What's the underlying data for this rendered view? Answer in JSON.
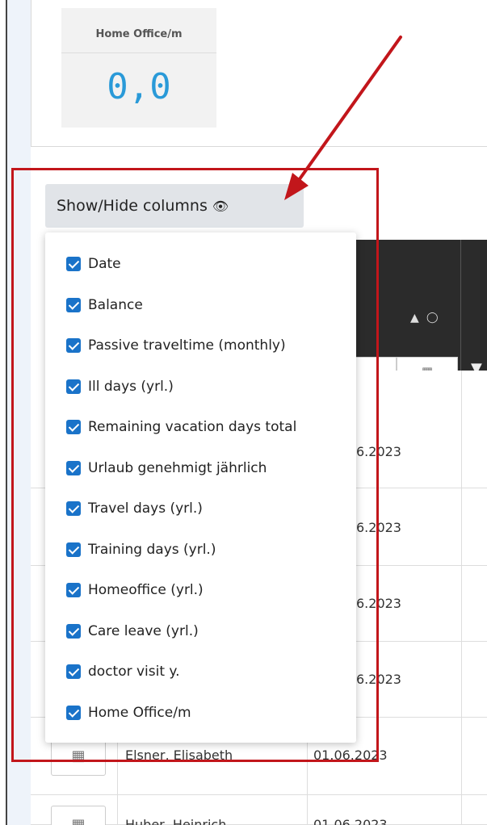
{
  "kpi": {
    "title": "Home Office/m",
    "value": "0,0"
  },
  "show_hide": {
    "label": "Show/Hide columns",
    "eye_icon": "eye-icon"
  },
  "columns": [
    {
      "label": "Date",
      "checked": true
    },
    {
      "label": "Balance",
      "checked": true
    },
    {
      "label": "Passive traveltime (monthly)",
      "checked": true
    },
    {
      "label": "Ill days (yrl.)",
      "checked": true
    },
    {
      "label": "Remaining vacation days total",
      "checked": true
    },
    {
      "label": "Urlaub genehmigt jährlich",
      "checked": true
    },
    {
      "label": "Travel days (yrl.)",
      "checked": true
    },
    {
      "label": "Training days (yrl.)",
      "checked": true
    },
    {
      "label": "Homeoffice (yrl.)",
      "checked": true
    },
    {
      "label": "Care leave (yrl.)",
      "checked": true
    },
    {
      "label": "doctor visit y.",
      "checked": true
    },
    {
      "label": "Home Office/m",
      "checked": true
    }
  ],
  "table": {
    "filter_placeholder": "-----",
    "rows": [
      {
        "date": "6.2023"
      },
      {
        "date": "6.2023"
      },
      {
        "date": "6.2023"
      },
      {
        "date": "6.2023"
      },
      {
        "name": "Elsner, Elisabeth",
        "date": "01.06.2023"
      },
      {
        "name": "Huber, Heinrich",
        "date": "01.06.2023"
      }
    ]
  },
  "colors": {
    "accent": "#2a9ad8",
    "checkbox": "#1a73c9",
    "highlight": "#c2161b",
    "header": "#2b2b2b"
  }
}
